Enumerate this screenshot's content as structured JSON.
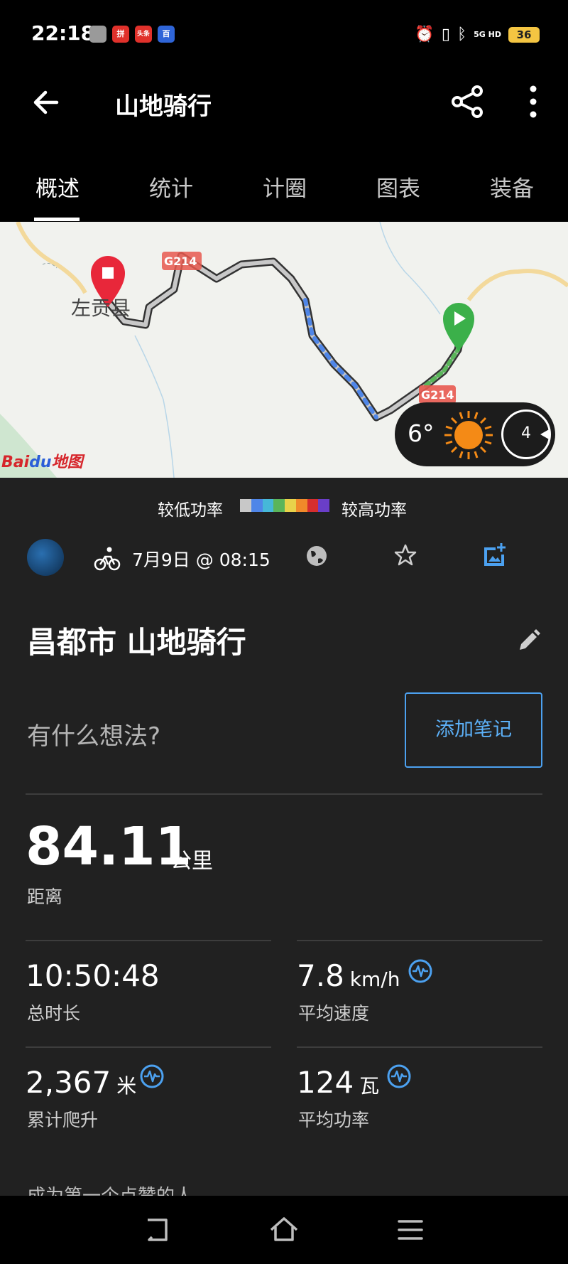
{
  "status_bar": {
    "time": "22:18",
    "app_icons": [
      {
        "name": "shopping-icon",
        "text": "",
        "color": "#9a9a9a"
      },
      {
        "name": "pinduoduo-icon",
        "text": "拼",
        "color": "#e0312b"
      },
      {
        "name": "toutiao-icon",
        "text": "头条",
        "color": "#e0312b"
      },
      {
        "name": "baidu-icon",
        "text": "百",
        "color": "#2f65d8"
      }
    ],
    "network": "5G HD",
    "battery": "36"
  },
  "app_bar": {
    "title": "山地骑行"
  },
  "tabs": [
    {
      "label": "概述",
      "active": true
    },
    {
      "label": "统计",
      "active": false
    },
    {
      "label": "计圈",
      "active": false
    },
    {
      "label": "图表",
      "active": false
    },
    {
      "label": "装备",
      "active": false
    }
  ],
  "map": {
    "town_label": "左贡县",
    "road_label_1": "G214",
    "road_label_2": "G214",
    "weather_temp": "6°",
    "wind_speed": "4",
    "provider_logo_text": "Bai",
    "provider_logo_accent": "du",
    "provider_logo_suffix": "地图"
  },
  "legend": {
    "low_label": "较低功率",
    "high_label": "较高功率",
    "colors": [
      "#c8c8c8",
      "#4f86e8",
      "#46b8d8",
      "#5ab55a",
      "#e8d24a",
      "#f08a2a",
      "#d62e2e",
      "#6a3ec8"
    ]
  },
  "activity": {
    "date": "7月9日 @ 08:15",
    "name": "昌都市 山地骑行",
    "thoughts_placeholder": "有什么想法?",
    "add_note_label": "添加笔记"
  },
  "stats": {
    "distance": {
      "value": "84.11",
      "unit": "公里",
      "label": "距离"
    },
    "total_time": {
      "value": "10:50:48",
      "label": "总时长"
    },
    "avg_speed": {
      "value": "7.8",
      "unit": "km/h",
      "label": "平均速度"
    },
    "total_ascent": {
      "value": "2,367",
      "unit": "米",
      "label": "累计爬升"
    },
    "avg_power": {
      "value": "124",
      "unit": "瓦",
      "label": "平均功率"
    }
  },
  "footer_text": "成为第一个点赞的人",
  "colors": {
    "accent_blue": "#4ca1f0",
    "background": "#212121",
    "start_green": "#3bb04a",
    "end_red": "#e8273a"
  }
}
